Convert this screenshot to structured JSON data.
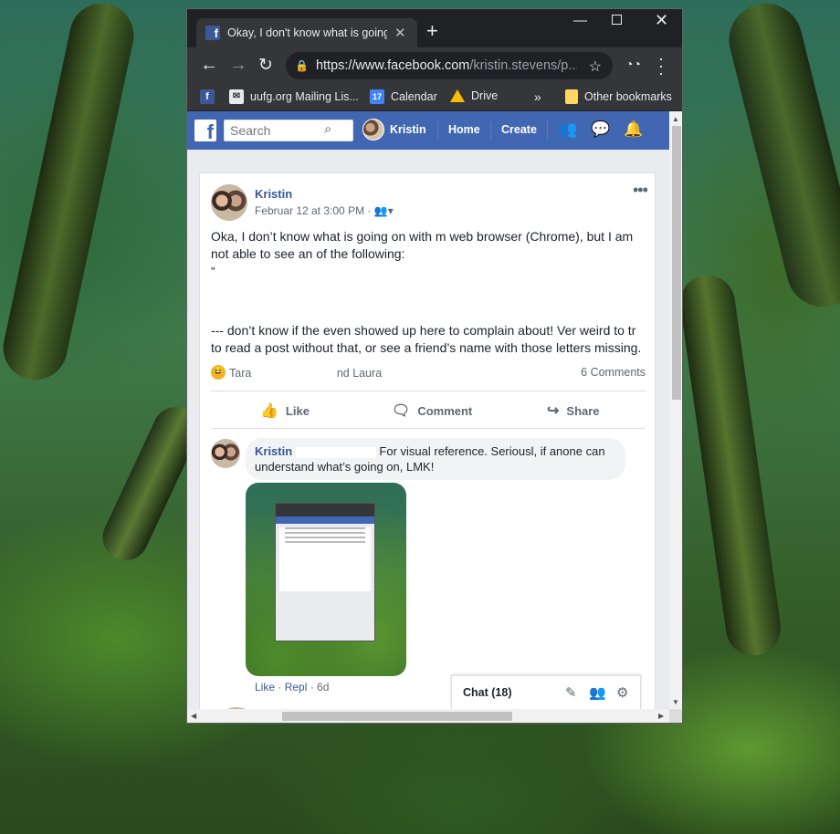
{
  "browser": {
    "tab_title": "Okay, I don't know what is going on",
    "tab_close": "✕",
    "new_tab": "+",
    "url_main": "https://www.facebook.com",
    "url_path": "/kristin.stevens/p...",
    "bookmarks": [
      {
        "label": ""
      },
      {
        "label": "uufg.org Mailing Lis..."
      },
      {
        "label": "Calendar"
      },
      {
        "label": "Drive"
      }
    ],
    "calendar_badge": "17",
    "more_bookmarks": "»",
    "other_bookmarks": "Other bookmarks"
  },
  "facebook": {
    "search_placeholder": "Search",
    "profile_name": "Kristin",
    "nav_home": "Home",
    "nav_create": "Create"
  },
  "post": {
    "author": "Kristin",
    "meta": "Februar 12 at 3:00 PM ·",
    "line1": "Oka, I don’t know what is going on with m web browser (Chrome), but I am not able to see an of the following:",
    "line2": "“",
    "line3": "--- don’t know if the even showed up here to complain about! Ver weird to tr to read a post without that, or see a friend’s name with those letters missing.",
    "react_name_start": "Tara",
    "react_name_end": "nd Laura",
    "comments_count": "6 Comments",
    "like": "Like",
    "comment": "Comment",
    "share": "Share"
  },
  "comment": {
    "author": "Kristin",
    "text": "For visual reference. Seriousl, if anone can understand what’s going on, LMK!",
    "like": "Like",
    "sep": " · ",
    "reply": "Repl",
    "age": "6d"
  },
  "chat": {
    "label": "Chat (18)"
  }
}
